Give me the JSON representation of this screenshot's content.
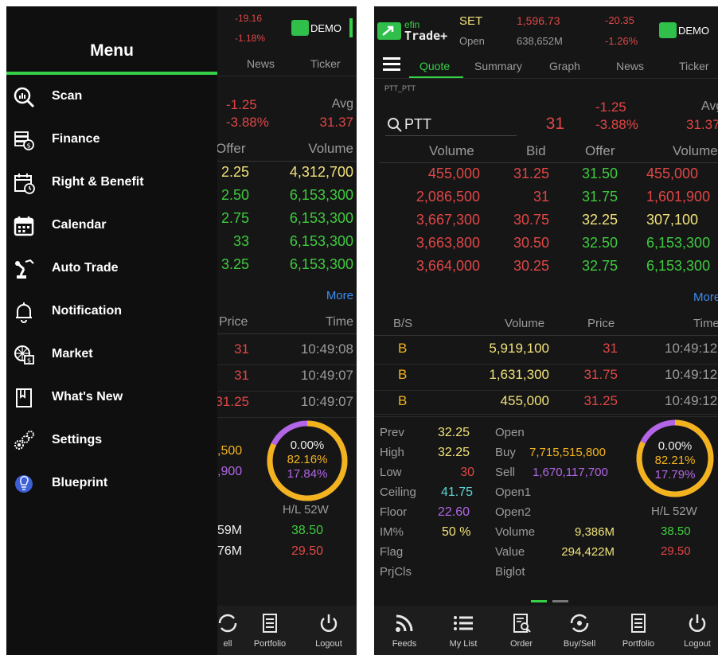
{
  "left": {
    "header": {
      "change": "-19.16",
      "change_pct": "-1.18%",
      "demo": "DEMO"
    },
    "tabs": [
      "News",
      "Ticker"
    ],
    "quote": {
      "change": "-1.25",
      "change_pct": "-3.88%",
      "avg_label": "Avg",
      "avg_value": "31.37"
    },
    "book_headers": {
      "offer": "Offer",
      "volume": "Volume"
    },
    "book": [
      {
        "offer": "2.25",
        "volume": "4,312,700"
      },
      {
        "offer": "2.50",
        "volume": "6,153,300"
      },
      {
        "offer": "2.75",
        "volume": "6,153,300"
      },
      {
        "offer": "33",
        "volume": "6,153,300"
      },
      {
        "offer": "3.25",
        "volume": "6,153,300"
      }
    ],
    "more": "More",
    "trade_headers": {
      "price": "Price",
      "time": "Time"
    },
    "trades": [
      {
        "price": "31",
        "time": "10:49:08"
      },
      {
        "price": "31",
        "time": "10:49:07"
      },
      {
        "price": "31.25",
        "time": "10:49:07"
      }
    ],
    "stats": {
      "v1": ",500",
      "v2": ",900",
      "v3": "59M",
      "v4": "76M"
    },
    "donut": {
      "neutral": "0.00%",
      "buy": "82.16%",
      "sell": "17.84%",
      "buy_frac": 0.8216
    },
    "hl52": {
      "label": "H/L 52W",
      "high": "38.50",
      "low": "29.50"
    },
    "tabbar": [
      {
        "label": "ell",
        "icon": "buy-sell-icon"
      },
      {
        "label": "Portfolio",
        "icon": "portfolio-icon"
      },
      {
        "label": "Logout",
        "icon": "logout-icon"
      }
    ]
  },
  "menu": {
    "title": "Menu",
    "items": [
      {
        "label": "Scan",
        "icon": "scan-icon"
      },
      {
        "label": "Finance",
        "icon": "finance-icon"
      },
      {
        "label": "Right & Benefit",
        "icon": "right-benefit-icon"
      },
      {
        "label": "Calendar",
        "icon": "calendar-icon"
      },
      {
        "label": "Auto Trade",
        "icon": "auto-trade-icon"
      },
      {
        "label": "Notification",
        "icon": "bell-icon"
      },
      {
        "label": "Market",
        "icon": "market-icon"
      },
      {
        "label": "What's New",
        "icon": "whats-new-icon"
      },
      {
        "label": "Settings",
        "icon": "gear-icon"
      },
      {
        "label": "Blueprint",
        "icon": "blueprint-icon"
      }
    ]
  },
  "right": {
    "header": {
      "logo_line1": "efin",
      "logo_line2": "Trade+",
      "market": "SET",
      "index": "1,596.73",
      "change": "-20.35",
      "open_label": "Open",
      "value": "638,652M",
      "change_pct": "-1.26%",
      "demo": "DEMO"
    },
    "tabs": [
      "Quote",
      "Summary",
      "Graph",
      "News",
      "Ticker"
    ],
    "symbol_code": "PTT_PTT",
    "search": {
      "value": "PTT"
    },
    "quote": {
      "last": "31",
      "change": "-1.25",
      "change_pct": "-3.88%",
      "avg_label": "Avg",
      "avg_value": "31.37"
    },
    "book_headers": {
      "volume": "Volume",
      "bid": "Bid",
      "offer": "Offer",
      "volume2": "Volume"
    },
    "book": [
      {
        "bid_vol": "455,000",
        "bid": "31.25",
        "offer": "31.50",
        "offer_vol": "455,000"
      },
      {
        "bid_vol": "2,086,500",
        "bid": "31",
        "offer": "31.75",
        "offer_vol": "1,601,900"
      },
      {
        "bid_vol": "3,667,300",
        "bid": "30.75",
        "offer": "32.25",
        "offer_vol": "307,100"
      },
      {
        "bid_vol": "3,663,800",
        "bid": "30.50",
        "offer": "32.50",
        "offer_vol": "6,153,300"
      },
      {
        "bid_vol": "3,664,000",
        "bid": "30.25",
        "offer": "32.75",
        "offer_vol": "6,153,300"
      }
    ],
    "more": "More",
    "trade_headers": {
      "bs": "B/S",
      "volume": "Volume",
      "price": "Price",
      "time": "Time"
    },
    "trades": [
      {
        "bs": "B",
        "volume": "5,919,100",
        "price": "31",
        "time": "10:49:12"
      },
      {
        "bs": "B",
        "volume": "1,631,300",
        "price": "31.75",
        "time": "10:49:12"
      },
      {
        "bs": "B",
        "volume": "455,000",
        "price": "31.25",
        "time": "10:49:12"
      }
    ],
    "info": {
      "prev_label": "Prev",
      "prev": "32.25",
      "high_label": "High",
      "high": "32.25",
      "low_label": "Low",
      "low": "30",
      "ceiling_label": "Ceiling",
      "ceiling": "41.75",
      "floor_label": "Floor",
      "floor": "22.60",
      "im_label": "IM%",
      "im": "50 %",
      "flag_label": "Flag",
      "prjcls_label": "PrjCls",
      "open_label": "Open",
      "buy_label": "Buy",
      "buy": "7,715,515,800",
      "sell_label": "Sell",
      "sell": "1,670,117,700",
      "open1_label": "Open1",
      "open2_label": "Open2",
      "volume_label": "Volume",
      "volume": "9,386M",
      "value_label": "Value",
      "value": "294,422M",
      "biglot_label": "Biglot"
    },
    "donut": {
      "neutral": "0.00%",
      "buy": "82.21%",
      "sell": "17.79%",
      "buy_frac": 0.8221
    },
    "hl52": {
      "label": "H/L 52W",
      "high": "38.50",
      "low": "29.50"
    },
    "tabbar": [
      {
        "label": "Feeds",
        "icon": "feeds-icon"
      },
      {
        "label": "My List",
        "icon": "my-list-icon"
      },
      {
        "label": "Order",
        "icon": "order-icon"
      },
      {
        "label": "Buy/Sell",
        "icon": "buy-sell-icon"
      },
      {
        "label": "Portfolio",
        "icon": "portfolio-icon"
      },
      {
        "label": "Logout",
        "icon": "logout-icon"
      }
    ]
  }
}
